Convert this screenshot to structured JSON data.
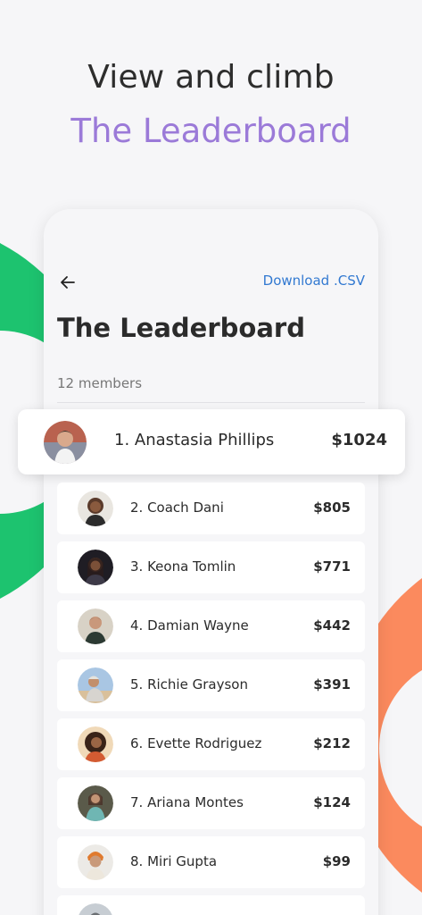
{
  "headline": "View and climb",
  "headline_accent": "The Leaderboard",
  "header": {
    "back_icon": "arrow-left-icon",
    "download_label": "Download .CSV"
  },
  "title": "The Leaderboard",
  "members_count": "12 members",
  "colors": {
    "accent_purple": "#9b7ad8",
    "link_blue": "#3279d1",
    "green": "#1dc36f",
    "orange": "#fb8a5e"
  },
  "leaders": [
    {
      "label": "1. Anastasia Phillips",
      "amount": "$1024"
    },
    {
      "label": "2. Coach Dani",
      "amount": "$805"
    },
    {
      "label": "3. Keona Tomlin",
      "amount": "$771"
    },
    {
      "label": "4. Damian Wayne",
      "amount": "$442"
    },
    {
      "label": "5. Richie Grayson",
      "amount": "$391"
    },
    {
      "label": "6. Evette Rodriguez",
      "amount": "$212"
    },
    {
      "label": "7. Ariana Montes",
      "amount": "$124"
    },
    {
      "label": "8. Miri Gupta",
      "amount": "$99"
    }
  ]
}
